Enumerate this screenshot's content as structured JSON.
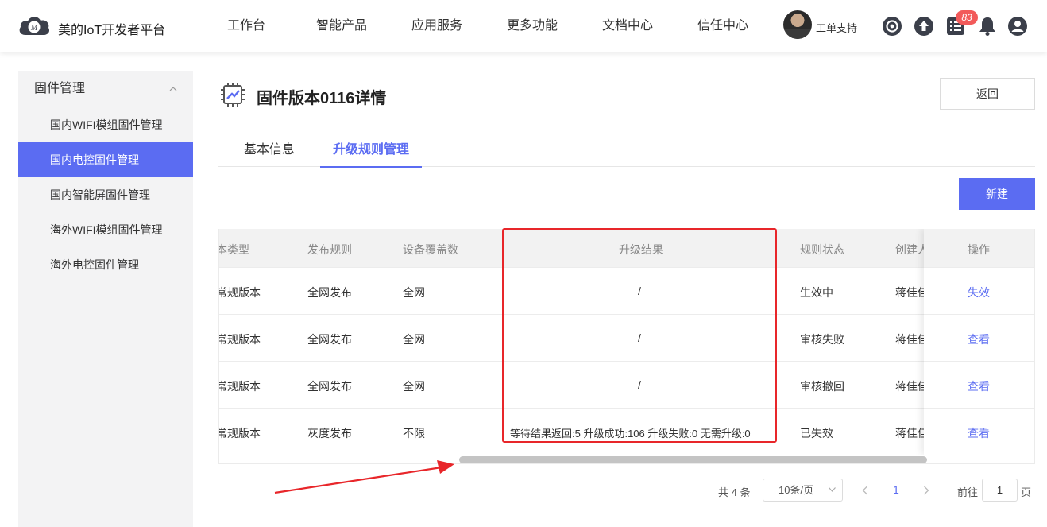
{
  "header": {
    "brand": "美的IoT开发者平台",
    "nav": [
      "工作台",
      "智能产品",
      "应用服务",
      "更多功能",
      "文档中心",
      "信任中心"
    ],
    "support_label": "工单支持",
    "notification_badge": "83"
  },
  "sidebar": {
    "group_title": "固件管理",
    "items": [
      {
        "label": "国内WIFI模组固件管理",
        "active": false
      },
      {
        "label": "国内电控固件管理",
        "active": true
      },
      {
        "label": "国内智能屏固件管理",
        "active": false
      },
      {
        "label": "海外WIFI模组固件管理",
        "active": false
      },
      {
        "label": "海外电控固件管理",
        "active": false
      }
    ]
  },
  "page": {
    "title": "固件版本0116详情",
    "back_label": "返回",
    "new_label": "新建",
    "tabs": [
      "基本信息",
      "升级规则管理"
    ],
    "active_tab": 1
  },
  "table": {
    "headers": [
      "本类型",
      "发布规则",
      "设备覆盖数",
      "升级结果",
      "规则状态",
      "创建人",
      "操作"
    ],
    "rows": [
      {
        "type": "常规版本",
        "rule": "全网发布",
        "coverage": "全网",
        "result": "/",
        "status": "生效中",
        "creator": "蒋佳佳",
        "action": "失效"
      },
      {
        "type": "常规版本",
        "rule": "全网发布",
        "coverage": "全网",
        "result": "/",
        "status": "审核失败",
        "creator": "蒋佳佳",
        "action": "查看"
      },
      {
        "type": "常规版本",
        "rule": "全网发布",
        "coverage": "全网",
        "result": "/",
        "status": "审核撤回",
        "creator": "蒋佳佳",
        "action": "查看"
      },
      {
        "type": "常规版本",
        "rule": "灰度发布",
        "coverage": "不限",
        "result": "等待结果返回:5 升级成功:106 升级失败:0 无需升级:0",
        "status": "已失效",
        "creator": "蒋佳佳",
        "action": "查看"
      }
    ]
  },
  "pagination": {
    "total": "共 4 条",
    "page_size": "10条/页",
    "current_page": "1",
    "goto_label": "前往",
    "goto_value": "1",
    "page_unit": "页"
  },
  "colors": {
    "accent": "#5b6cf2",
    "highlight": "#e8262a",
    "badge": "#f25a5a"
  }
}
